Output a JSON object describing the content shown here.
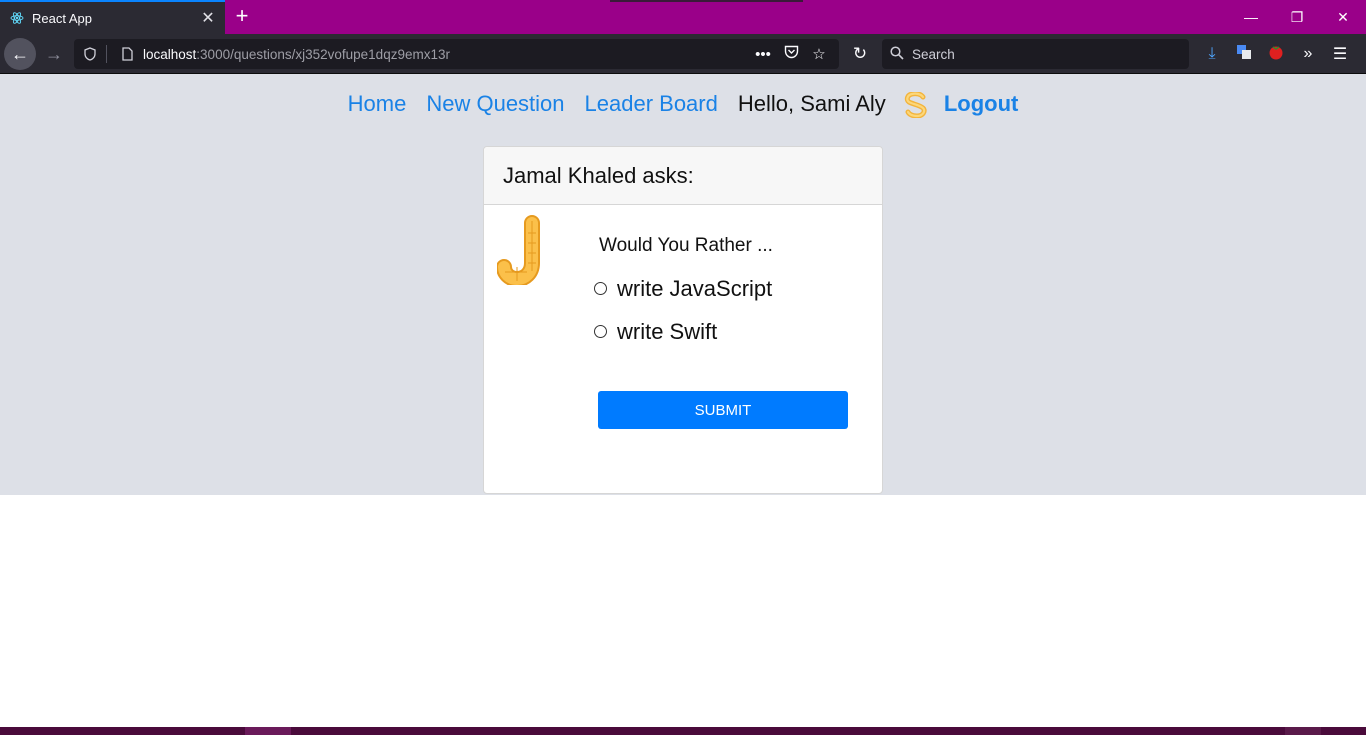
{
  "browser": {
    "tab_title": "React App",
    "tab_close": "✕",
    "new_tab": "+",
    "url_host": "localhost",
    "url_rest": ":3000/questions/xj352vofupe1dqz9emx13r",
    "search_placeholder": "Search",
    "window_controls": {
      "minimize": "—",
      "restore": "❐",
      "close": "✕"
    }
  },
  "nav": {
    "home": "Home",
    "new_question": "New Question",
    "leader_board": "Leader Board",
    "greeting": "Hello, Sami Aly",
    "logout": "Logout"
  },
  "question": {
    "author_heading": "Jamal Khaled asks:",
    "prompt": "Would You Rather ...",
    "options": [
      {
        "label": "write JavaScript",
        "selected": false
      },
      {
        "label": "write Swift",
        "selected": false
      }
    ],
    "submit_label": "SUBMIT"
  },
  "colors": {
    "tabbar": "#9a0089",
    "page_bg": "#dde0e7",
    "link": "#1a82e6",
    "button": "#007bff"
  }
}
